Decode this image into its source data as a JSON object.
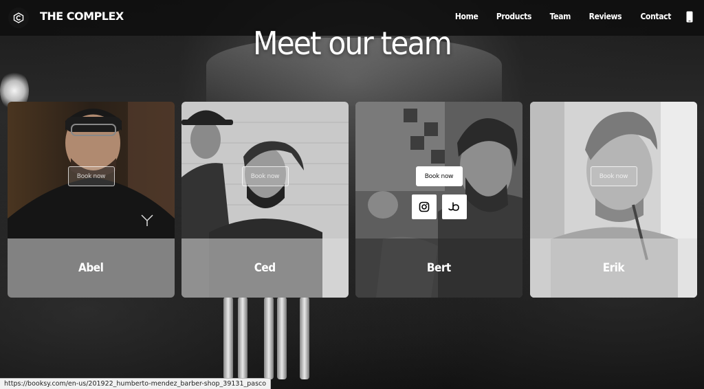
{
  "brand": {
    "name": "THE COMPLEX",
    "logo_icon": "complex-logo-icon"
  },
  "nav": {
    "items": [
      "Home",
      "Products",
      "Team",
      "Reviews",
      "Contact"
    ],
    "phone_icon": "phone-icon"
  },
  "section": {
    "title": "Meet our team"
  },
  "team": [
    {
      "name": "Abel",
      "book_label": "Book now",
      "state": "dim"
    },
    {
      "name": "Ced",
      "book_label": "Book now",
      "state": "dim"
    },
    {
      "name": "Bert",
      "book_label": "Book now",
      "state": "hover",
      "socials": [
        "instagram-icon",
        "booksy-icon"
      ]
    },
    {
      "name": "Erik",
      "book_label": "Book now",
      "state": "dim"
    }
  ],
  "status_bar": {
    "url": "https://booksy.com/en-us/201922_humberto-mendez_barber-shop_39131_pasco"
  },
  "colors": {
    "header_bg": "#0f0f0f",
    "text": "#ffffff",
    "band_light": "#dcdcdc",
    "band_dark": "#282828"
  }
}
